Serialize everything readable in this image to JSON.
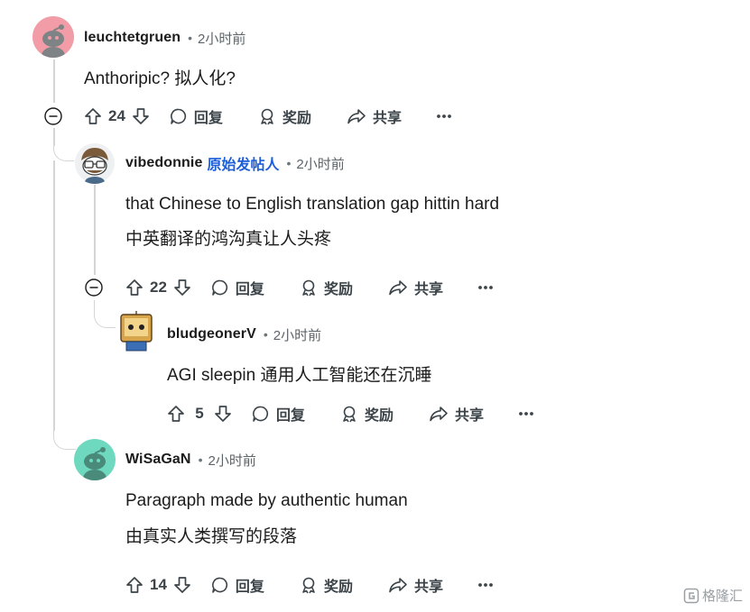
{
  "comments": [
    {
      "username": "leuchtetgruen",
      "time": "2小时前",
      "lines": [
        "Anthoripic?   拟人化?"
      ],
      "score": "24",
      "avatar_color": "#f19ca6"
    },
    {
      "username": "vibedonnie",
      "op_label": "原始发帖人",
      "time": "2小时前",
      "lines": [
        "that Chinese to English translation gap hittin hard",
        "中英翻译的鸿沟真让人头疼"
      ],
      "score": "22"
    },
    {
      "username": "bludgeonerV",
      "time": "2小时前",
      "lines": [
        "AGI sleepin   通用人工智能还在沉睡"
      ],
      "score": "5"
    },
    {
      "username": "WiSaGaN",
      "time": "2小时前",
      "lines": [
        "Paragraph made by authentic human",
        "由真实人类撰写的段落"
      ],
      "score": "14",
      "avatar_color": "#6fd9c0"
    }
  ],
  "actions": {
    "reply": "回复",
    "award": "奖励",
    "share": "共享",
    "more": "···"
  },
  "separator": "•",
  "watermark": "格隆汇",
  "colors": {
    "op_blue": "#1d5ed8",
    "text": "#1c1c1c",
    "muted": "#5c6469",
    "line": "#d2d6d9"
  }
}
